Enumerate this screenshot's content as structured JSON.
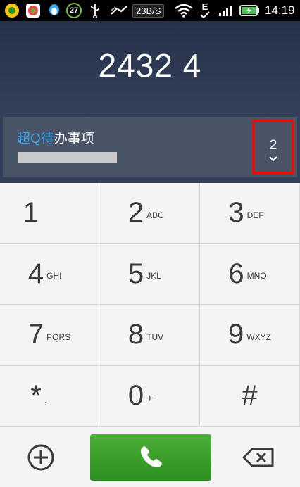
{
  "status_bar": {
    "notification_count": "27",
    "network_speed": "23B/S",
    "carrier_mode": "E",
    "time": "14:19"
  },
  "dialer": {
    "number": "2432 4"
  },
  "suggestion": {
    "title_prefix": "超",
    "title_highlight": "Q待",
    "title_suffix": "办事项",
    "match_count": "2"
  },
  "keypad": {
    "keys": [
      {
        "digit": "1",
        "letters": ""
      },
      {
        "digit": "2",
        "letters": "ABC"
      },
      {
        "digit": "3",
        "letters": "DEF"
      },
      {
        "digit": "4",
        "letters": "GHI"
      },
      {
        "digit": "5",
        "letters": "JKL"
      },
      {
        "digit": "6",
        "letters": "MNO"
      },
      {
        "digit": "7",
        "letters": "PQRS"
      },
      {
        "digit": "8",
        "letters": "TUV"
      },
      {
        "digit": "9",
        "letters": "WXYZ"
      },
      {
        "digit": "*",
        "letters": ","
      },
      {
        "digit": "0",
        "letters": "+"
      },
      {
        "digit": "#",
        "letters": ""
      }
    ]
  },
  "colors": {
    "accent_blue": "#3aa6f0",
    "call_green": "#3ca52c",
    "highlight_red": "#e01010"
  }
}
